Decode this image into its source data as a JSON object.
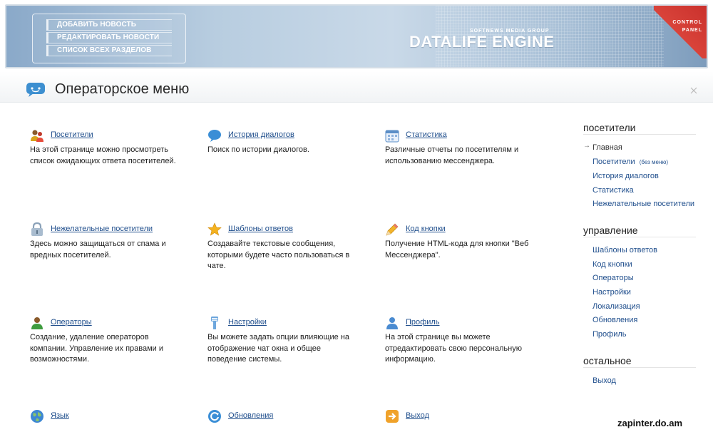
{
  "header": {
    "menu": [
      "ДОБАВИТЬ НОВОСТЬ",
      "РЕДАКТИРОВАТЬ НОВОСТИ",
      "СПИСОК ВСЕХ РАЗДЕЛОВ"
    ],
    "brand_sub": "SOFTNEWS MEDIA GROUP",
    "brand": "DATALIFE ENGINE",
    "corner_line1": "CONTROL",
    "corner_line2": "PANEL"
  },
  "page_title": "Операторское меню",
  "cards": [
    {
      "icon": "visitors-icon",
      "title": "Посетители",
      "desc": "На этой странице можно просмотреть список ожидающих ответа посетителей."
    },
    {
      "icon": "chat-bubble-icon",
      "title": "История диалогов",
      "desc": "Поиск по истории диалогов."
    },
    {
      "icon": "calendar-icon",
      "title": "Статистика",
      "desc": "Различные отчеты по посетителям и использованию мессенджера."
    },
    {
      "icon": "lock-icon",
      "title": "Нежелательные посетители",
      "desc": "Здесь можно защищаться от спама и вредных посетителей."
    },
    {
      "icon": "star-icon",
      "title": "Шаблоны ответов",
      "desc": "Создавайте текстовые сообщения, которыми будете часто пользоваться в чате."
    },
    {
      "icon": "pencil-icon",
      "title": "Код кнопки",
      "desc": "Получение HTML-кода для кнопки \"Веб Мессенджера\"."
    },
    {
      "icon": "operator-icon",
      "title": "Операторы",
      "desc": "Создание, удаление операторов компании. Управление их правами и возможностями."
    },
    {
      "icon": "settings-icon",
      "title": "Настройки",
      "desc": "Вы можете задать опции влияющие на отображение чат окна и общее поведение системы."
    },
    {
      "icon": "profile-icon",
      "title": "Профиль",
      "desc": "На этой странице вы можете отредактировать свою персональную информацию."
    },
    {
      "icon": "globe-icon",
      "title": "Язык",
      "desc": ""
    },
    {
      "icon": "update-icon",
      "title": "Обновления",
      "desc": ""
    },
    {
      "icon": "exit-icon",
      "title": "Выход",
      "desc": ""
    }
  ],
  "sidebar": {
    "visitors_heading": "посетители",
    "visitors_items": [
      "Главная",
      "Посетители",
      "История диалогов",
      "Статистика",
      "Нежелательные посетители"
    ],
    "visitors_note": "(без меню)",
    "manage_heading": "управление",
    "manage_items": [
      "Шаблоны ответов",
      "Код кнопки",
      "Операторы",
      "Настройки",
      "Локализация",
      "Обновления",
      "Профиль"
    ],
    "other_heading": "остальное",
    "other_items": [
      "Выход"
    ]
  },
  "watermark": "zapinter.do.am",
  "colors": {
    "link": "#1f4e8c",
    "banner": "#b8cde0",
    "corner": "#c9302c"
  }
}
